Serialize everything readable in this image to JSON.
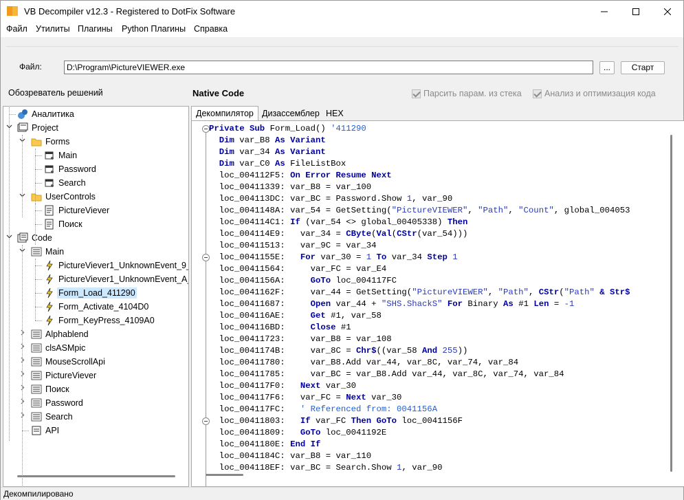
{
  "window": {
    "title": "VB Decompiler v12.3 - Registered to DotFix Software",
    "minimize_icon": "minimize-icon",
    "maximize_icon": "maximize-icon",
    "close_icon": "close-icon"
  },
  "menu": [
    "Файл",
    "Утилиты",
    "Плагины",
    "Python Плагины",
    "Справка"
  ],
  "file": {
    "label": "Файл:",
    "path": "D:\\Program\\PictureVIEWER.exe",
    "browse_label": "...",
    "start_label": "Старт"
  },
  "panels": {
    "solution_explorer": "Обозреватель решений",
    "native_code": "Native Code"
  },
  "options": {
    "parse_stack": "Парсить парам. из стека",
    "analysis": "Анализ и оптимизация кода"
  },
  "tree": [
    {
      "label": "Аналитика",
      "icon": "analytics-icon",
      "level": 1,
      "exp": ""
    },
    {
      "label": "Project",
      "icon": "project-icon",
      "level": 1,
      "exp": "v"
    },
    {
      "label": "Forms",
      "icon": "folder-icon",
      "level": 2,
      "exp": "v"
    },
    {
      "label": "Main",
      "icon": "form-icon",
      "level": 3,
      "exp": ""
    },
    {
      "label": "Password",
      "icon": "form-icon",
      "level": 3,
      "exp": ""
    },
    {
      "label": "Search",
      "icon": "form-icon",
      "level": 3,
      "exp": ""
    },
    {
      "label": "UserControls",
      "icon": "folder-icon",
      "level": 2,
      "exp": "v"
    },
    {
      "label": "PictureViever",
      "icon": "usercontrol-icon",
      "level": 3,
      "exp": ""
    },
    {
      "label": "Поиск",
      "icon": "usercontrol-icon",
      "level": 3,
      "exp": ""
    },
    {
      "label": "Code",
      "icon": "code-icon",
      "level": 1,
      "exp": "v"
    },
    {
      "label": "Main",
      "icon": "module-icon",
      "level": 2,
      "exp": "v"
    },
    {
      "label": "PictureViever1_UnknownEvent_9_",
      "icon": "event-icon",
      "level": 3,
      "exp": ""
    },
    {
      "label": "PictureViever1_UnknownEvent_A_",
      "icon": "event-icon",
      "level": 3,
      "exp": ""
    },
    {
      "label": "Form_Load_411290",
      "icon": "event-icon",
      "level": 3,
      "exp": "",
      "selected": true
    },
    {
      "label": "Form_Activate_4104D0",
      "icon": "event-icon",
      "level": 3,
      "exp": ""
    },
    {
      "label": "Form_KeyPress_4109A0",
      "icon": "event-icon",
      "level": 3,
      "exp": ""
    },
    {
      "label": "Alphablend",
      "icon": "module-icon",
      "level": 2,
      "exp": ">"
    },
    {
      "label": "clsASMpic",
      "icon": "module-icon",
      "level": 2,
      "exp": ">"
    },
    {
      "label": "MouseScrollApi",
      "icon": "module-icon",
      "level": 2,
      "exp": ">"
    },
    {
      "label": "PictureViever",
      "icon": "module-icon",
      "level": 2,
      "exp": ">"
    },
    {
      "label": "Поиск",
      "icon": "module-icon",
      "level": 2,
      "exp": ">"
    },
    {
      "label": "Password",
      "icon": "module-icon",
      "level": 2,
      "exp": ">"
    },
    {
      "label": "Search",
      "icon": "module-icon",
      "level": 2,
      "exp": ">"
    },
    {
      "label": "API",
      "icon": "api-icon",
      "level": 2,
      "exp": ""
    }
  ],
  "tabs": [
    "Декомпилятор",
    "Дизассемблер",
    "HEX Редактор"
  ],
  "code_lines": [
    [
      [
        "kw",
        "Private Sub "
      ],
      [
        "",
        "Form_Load() "
      ],
      [
        "cm",
        "'411290"
      ]
    ],
    [
      [
        "",
        "  "
      ],
      [
        "kw",
        "Dim "
      ],
      [
        "",
        "var_B8 "
      ],
      [
        "kw",
        "As Variant"
      ]
    ],
    [
      [
        "",
        "  "
      ],
      [
        "kw",
        "Dim "
      ],
      [
        "",
        "var_34 "
      ],
      [
        "kw",
        "As Variant"
      ]
    ],
    [
      [
        "",
        "  "
      ],
      [
        "kw",
        "Dim "
      ],
      [
        "",
        "var_C0 "
      ],
      [
        "kw",
        "As "
      ],
      [
        "",
        "FileListBox"
      ]
    ],
    [
      [
        "",
        "  loc_004112F5: "
      ],
      [
        "kw",
        "On Error Resume Next"
      ]
    ],
    [
      [
        "",
        "  loc_00411339: var_B8 = var_100"
      ]
    ],
    [
      [
        "",
        "  loc_004113DC: var_BC = Password.Show "
      ],
      [
        "st",
        "1"
      ],
      [
        "",
        ", var_90"
      ]
    ],
    [
      [
        "",
        "  loc_0041148A: var_54 = GetSetting("
      ],
      [
        "st",
        "\"PictureVIEWER\""
      ],
      [
        "",
        ", "
      ],
      [
        "st",
        "\"Path\""
      ],
      [
        "",
        ", "
      ],
      [
        "st",
        "\"Count\""
      ],
      [
        "",
        ", global_004053"
      ]
    ],
    [
      [
        "",
        "  loc_004114C1: "
      ],
      [
        "kw",
        "If "
      ],
      [
        "",
        "(var_54 <> global_00405338) "
      ],
      [
        "kw",
        "Then"
      ]
    ],
    [
      [
        "",
        "  loc_004114E9:   var_34 = "
      ],
      [
        "kw",
        "CByte"
      ],
      [
        "",
        "("
      ],
      [
        "kw",
        "Val"
      ],
      [
        "",
        "("
      ],
      [
        "kw",
        "CStr"
      ],
      [
        "",
        "(var_54)))"
      ]
    ],
    [
      [
        "",
        "  loc_00411513:   var_9C = var_34"
      ]
    ],
    [
      [
        "",
        "  loc_0041155E:   "
      ],
      [
        "kw",
        "For "
      ],
      [
        "",
        "var_30 = "
      ],
      [
        "st",
        "1"
      ],
      [
        "kw",
        " To "
      ],
      [
        "",
        "var_34 "
      ],
      [
        "kw",
        "Step "
      ],
      [
        "st",
        "1"
      ]
    ],
    [
      [
        "",
        "  loc_00411564:     var_FC = var_E4"
      ]
    ],
    [
      [
        "",
        "  loc_0041156A:     "
      ],
      [
        "kw",
        "GoTo "
      ],
      [
        "",
        "loc_004117FC"
      ]
    ],
    [
      [
        "",
        "  loc_0041162F:     var_44 = GetSetting("
      ],
      [
        "st",
        "\"PictureVIEWER\""
      ],
      [
        "",
        ", "
      ],
      [
        "st",
        "\"Path\""
      ],
      [
        "",
        ", "
      ],
      [
        "kw",
        "CStr"
      ],
      [
        "",
        "("
      ],
      [
        "st",
        "\"Path\""
      ],
      [
        "kw",
        " & "
      ],
      [
        "kw",
        "Str$"
      ]
    ],
    [
      [
        "",
        "  loc_00411687:     "
      ],
      [
        "kw",
        "Open "
      ],
      [
        "",
        "var_44 + "
      ],
      [
        "st",
        "\"SHS.ShackS\""
      ],
      [
        "kw",
        " For "
      ],
      [
        "",
        "Binary "
      ],
      [
        "kw",
        "As "
      ],
      [
        "",
        "#1 "
      ],
      [
        "kw",
        "Len "
      ],
      [
        "",
        "= "
      ],
      [
        "st",
        "-1"
      ]
    ],
    [
      [
        "",
        "  loc_004116AE:     "
      ],
      [
        "kw",
        "Get "
      ],
      [
        "",
        "#1, var_58"
      ]
    ],
    [
      [
        "",
        "  loc_004116BD:     "
      ],
      [
        "kw",
        "Close "
      ],
      [
        "",
        "#1"
      ]
    ],
    [
      [
        "",
        "  loc_00411723:     var_B8 = var_108"
      ]
    ],
    [
      [
        "",
        "  loc_0041174B:     var_8C = "
      ],
      [
        "kw",
        "Chr$"
      ],
      [
        "",
        "((var_58 "
      ],
      [
        "kw",
        "And "
      ],
      [
        "st",
        "255"
      ],
      [
        "",
        "))"
      ]
    ],
    [
      [
        "",
        "  loc_00411780:     var_B8.Add var_44, var_8C, var_74, var_84"
      ]
    ],
    [
      [
        "",
        "  loc_00411785:     var_BC = var_B8.Add var_44, var_8C, var_74, var_84"
      ]
    ],
    [
      [
        "",
        "  loc_004117F0:   "
      ],
      [
        "kw",
        "Next "
      ],
      [
        "",
        "var_30"
      ]
    ],
    [
      [
        "",
        "  loc_004117F6:   var_FC = "
      ],
      [
        "kw",
        "Next "
      ],
      [
        "",
        "var_30"
      ]
    ],
    [
      [
        "",
        "  loc_004117FC:   "
      ],
      [
        "cm",
        "' Referenced from: 0041156A"
      ]
    ],
    [
      [
        "",
        "  loc_00411803:   "
      ],
      [
        "kw",
        "If "
      ],
      [
        "",
        "var_FC "
      ],
      [
        "kw",
        "Then GoTo "
      ],
      [
        "",
        "loc_0041156F"
      ]
    ],
    [
      [
        "",
        "  loc_00411809:   "
      ],
      [
        "kw",
        "GoTo "
      ],
      [
        "",
        "loc_0041192E"
      ]
    ],
    [
      [
        "",
        "  loc_0041180E: "
      ],
      [
        "kw",
        "End If"
      ]
    ],
    [
      [
        "",
        "  loc_0041184C: var_B8 = var_110"
      ]
    ],
    [
      [
        "",
        "  loc_004118EF: var_BC = Search.Show "
      ],
      [
        "st",
        "1"
      ],
      [
        "",
        ", var_90"
      ]
    ]
  ],
  "status": "Декомпилировано"
}
